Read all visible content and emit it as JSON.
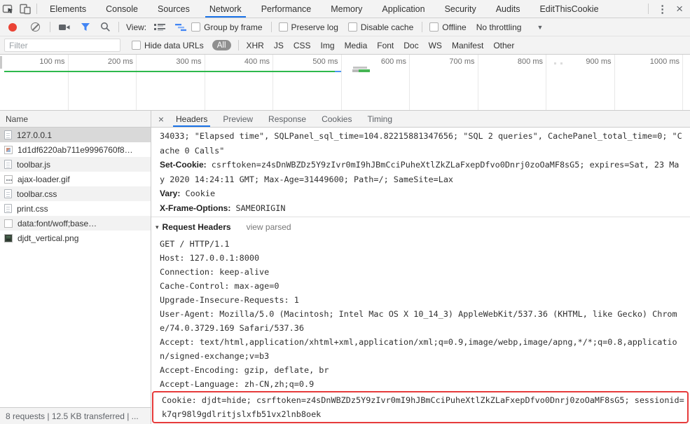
{
  "window": {
    "kebab_icon": "⋮",
    "close_icon": "×"
  },
  "main_tabs": {
    "items": [
      {
        "label": "Elements"
      },
      {
        "label": "Console"
      },
      {
        "label": "Sources"
      },
      {
        "label": "Network",
        "active": true
      },
      {
        "label": "Performance"
      },
      {
        "label": "Memory"
      },
      {
        "label": "Application"
      },
      {
        "label": "Security"
      },
      {
        "label": "Audits"
      },
      {
        "label": "EditThisCookie"
      }
    ]
  },
  "toolbar": {
    "view_label": "View:",
    "checkbox_labels": [
      "Group by frame",
      "Preserve log",
      "Disable cache",
      "Offline"
    ],
    "throttling": "No throttling",
    "dropdown_arrow": "▼"
  },
  "filter_bar": {
    "placeholder": "Filter",
    "hide_data_urls": "Hide data URLs",
    "all": "All",
    "types": [
      "XHR",
      "JS",
      "CSS",
      "Img",
      "Media",
      "Font",
      "Doc",
      "WS",
      "Manifest",
      "Other"
    ]
  },
  "timeline": {
    "labels": [
      "100 ms",
      "200 ms",
      "300 ms",
      "400 ms",
      "500 ms",
      "600 ms",
      "700 ms",
      "800 ms",
      "900 ms",
      "1000 ms"
    ]
  },
  "requests": {
    "column": "Name",
    "rows": [
      {
        "name": "127.0.0.1",
        "icon": "document-icon",
        "selected": true
      },
      {
        "name": "1d1df6220ab711e9996760f8…",
        "icon": "image-icon"
      },
      {
        "name": "toolbar.js",
        "icon": "document-icon"
      },
      {
        "name": "ajax-loader.gif",
        "icon": "image-icon"
      },
      {
        "name": "toolbar.css",
        "icon": "document-icon"
      },
      {
        "name": "print.css",
        "icon": "document-icon"
      },
      {
        "name": "data:font/woff;base…",
        "icon": "font-icon"
      },
      {
        "name": "djdt_vertical.png",
        "icon": "image-icon"
      }
    ],
    "summary": "8 requests | 12.5 KB transferred | ..."
  },
  "details": {
    "close": "×",
    "tabs": [
      {
        "label": "Headers",
        "active": true
      },
      {
        "label": "Preview"
      },
      {
        "label": "Response"
      },
      {
        "label": "Cookies"
      },
      {
        "label": "Timing"
      }
    ],
    "response_lines": [
      {
        "name": "",
        "value": "34033; \"Elapsed time\", SQLPanel_sql_time=104.82215881347656; \"SQL 2 queries\", CachePanel_total_time=0; \"C"
      },
      {
        "name": "",
        "value": "ache 0 Calls\""
      },
      {
        "name": "Set-Cookie:",
        "value": " csrftoken=z4sDnWBZDz5Y9zIvr0mI9hJBmCciPuheXtlZkZLaFxepDfvo0Dnrj0zoOaMF8sG5; expires=Sat, 23 Ma"
      },
      {
        "name": "",
        "value": "y 2020 14:24:11 GMT; Max-Age=31449600; Path=/; SameSite=Lax"
      },
      {
        "name": "Vary:",
        "value": " Cookie"
      },
      {
        "name": "X-Frame-Options:",
        "value": " SAMEORIGIN"
      }
    ],
    "request_section": {
      "expander": "▾",
      "title": "Request Headers",
      "toggle": "view parsed"
    },
    "request_lines": [
      "GET / HTTP/1.1",
      "Host: 127.0.0.1:8000",
      "Connection: keep-alive",
      "Cache-Control: max-age=0",
      "Upgrade-Insecure-Requests: 1",
      "User-Agent: Mozilla/5.0 (Macintosh; Intel Mac OS X 10_14_3) AppleWebKit/537.36 (KHTML, like Gecko) Chrom",
      "e/74.0.3729.169 Safari/537.36",
      "Accept: text/html,application/xhtml+xml,application/xml;q=0.9,image/webp,image/apng,*/*;q=0.8,applicatio",
      "n/signed-exchange;v=b3",
      "Accept-Encoding: gzip, deflate, br",
      "Accept-Language: zh-CN,zh;q=0.9"
    ],
    "cookie_lines": [
      "Cookie: djdt=hide; csrftoken=z4sDnWBZDz5Y9zIvr0mI9hJBmCciPuheXtlZkZLaFxepDfvo0Dnrj0zoOaMF8sG5; sessionid=",
      "k7qr98l9gdlritjslxfb51vx2lnb8oek"
    ]
  },
  "colors": {
    "accent_blue": "#1a73e8",
    "record_red": "#ea4335",
    "filter_funnel_blue": "#4285f4",
    "overview_green": "#2eb94d",
    "overview_blue": "#4b96f0",
    "highlight_red": "#e63b3b",
    "selected_row_gray": "#d9d9d9",
    "toolbar_gray": "#f3f3f3"
  }
}
